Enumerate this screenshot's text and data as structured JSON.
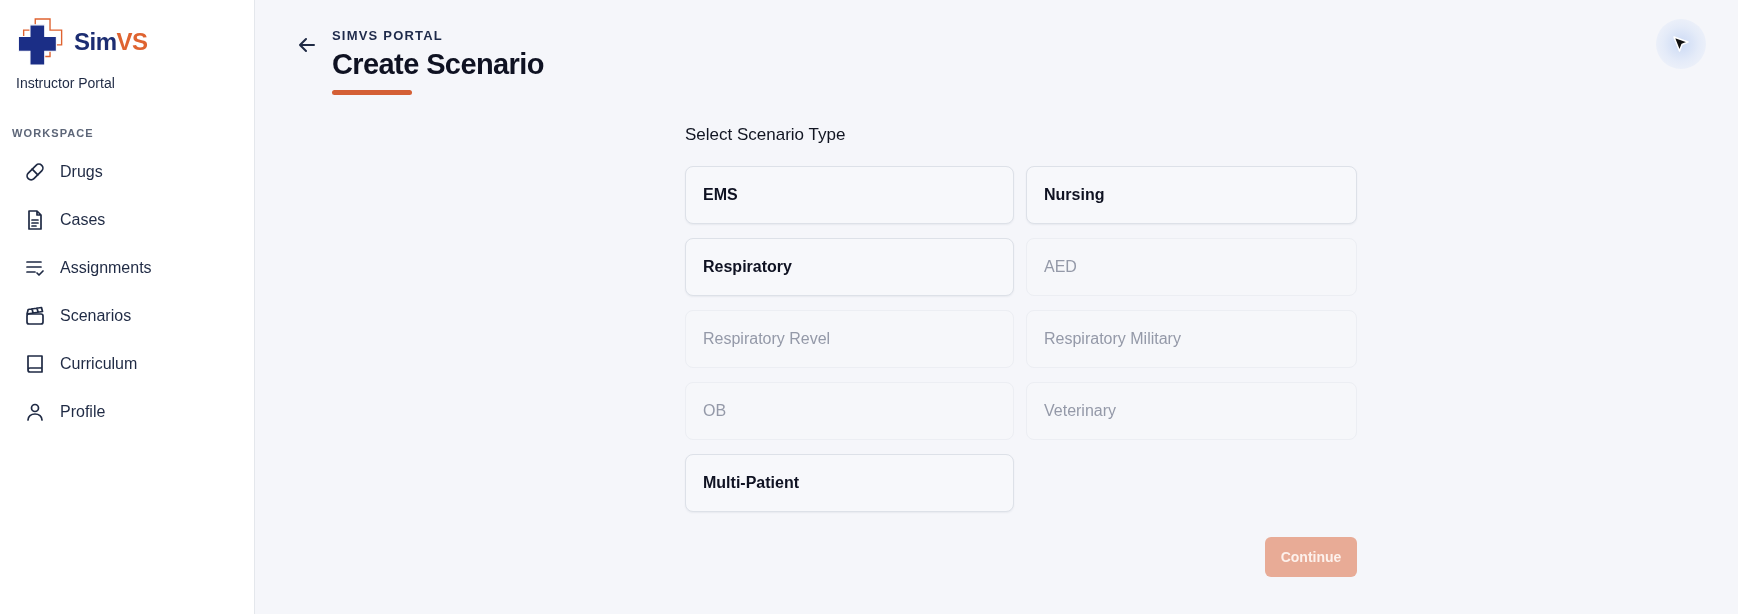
{
  "sidebar": {
    "logo": {
      "name": "Sim",
      "name_accent": "VS"
    },
    "subtitle": "Instructor Portal",
    "section_label": "WORKSPACE",
    "items": [
      {
        "label": "Drugs",
        "selected": false
      },
      {
        "label": "Cases",
        "selected": false
      },
      {
        "label": "Assignments",
        "selected": false
      },
      {
        "label": "Scenarios",
        "selected": false
      },
      {
        "label": "Curriculum",
        "selected": false
      },
      {
        "label": "Profile",
        "selected": false
      }
    ]
  },
  "header": {
    "eyebrow": "SIMVS PORTAL",
    "title": "Create Scenario"
  },
  "scenario_picker": {
    "heading": "Select Scenario Type",
    "options": [
      {
        "label": "EMS",
        "disabled": false,
        "selected": false
      },
      {
        "label": "Nursing",
        "disabled": false,
        "selected": false
      },
      {
        "label": "Respiratory",
        "disabled": false,
        "selected": false
      },
      {
        "label": "AED",
        "disabled": true,
        "selected": false
      },
      {
        "label": "Respiratory Revel",
        "disabled": true,
        "selected": false
      },
      {
        "label": "Respiratory Military",
        "disabled": true,
        "selected": false
      },
      {
        "label": "OB",
        "disabled": true,
        "selected": false
      },
      {
        "label": "Veterinary",
        "disabled": true,
        "selected": false
      },
      {
        "label": "Multi-Patient",
        "disabled": false,
        "selected": false
      }
    ]
  },
  "continue_button": {
    "label": "Continue",
    "disabled": true
  }
}
